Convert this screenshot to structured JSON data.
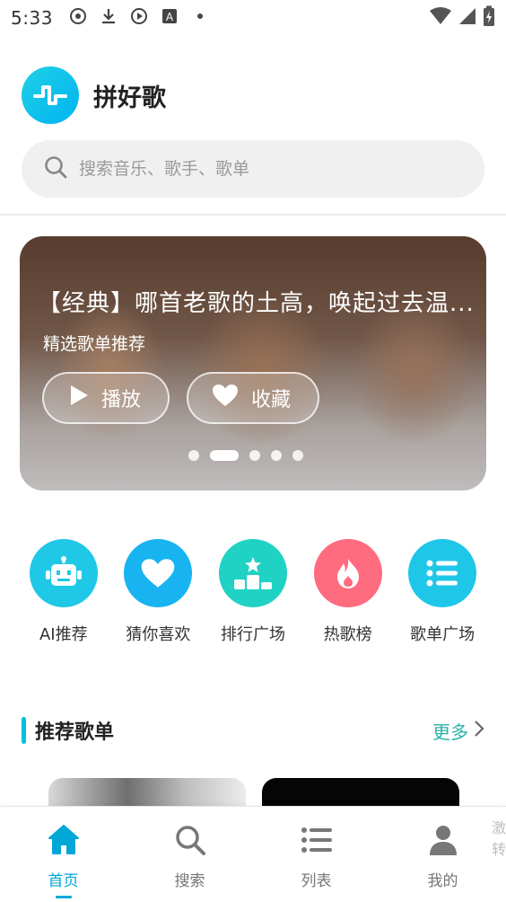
{
  "status_bar": {
    "time": "5:33"
  },
  "app": {
    "title": "拼好歌"
  },
  "search": {
    "placeholder": "搜索音乐、歌手、歌单"
  },
  "banner": {
    "title": "【经典】哪首老歌的土高，唤起过去温...",
    "subtitle": "精选歌单推荐",
    "play_label": "播放",
    "favorite_label": "收藏",
    "dot_count": 5,
    "active_dot": 2
  },
  "categories": [
    {
      "label": "AI推荐",
      "icon": "robot-icon",
      "color": "#1fc8e6"
    },
    {
      "label": "猜你喜欢",
      "icon": "heart-icon",
      "color": "#18b4f2"
    },
    {
      "label": "排行广场",
      "icon": "podium-icon",
      "color": "#20d2c4"
    },
    {
      "label": "热歌榜",
      "icon": "flame-icon",
      "color": "#ff6b7f"
    },
    {
      "label": "歌单广场",
      "icon": "list-icon",
      "color": "#1ec6e8"
    }
  ],
  "section": {
    "title": "推荐歌单",
    "more_label": "更多"
  },
  "bottom_nav": {
    "items": [
      {
        "label": "首页",
        "icon": "home-icon",
        "active": true
      },
      {
        "label": "搜索",
        "icon": "search-icon",
        "active": false
      },
      {
        "label": "列表",
        "icon": "list-icon",
        "active": false
      },
      {
        "label": "我的",
        "icon": "user-icon",
        "active": false
      }
    ]
  },
  "side_edge_text": "激转",
  "colors": {
    "accent": "#00a6d6",
    "more": "#2bb2a8"
  }
}
